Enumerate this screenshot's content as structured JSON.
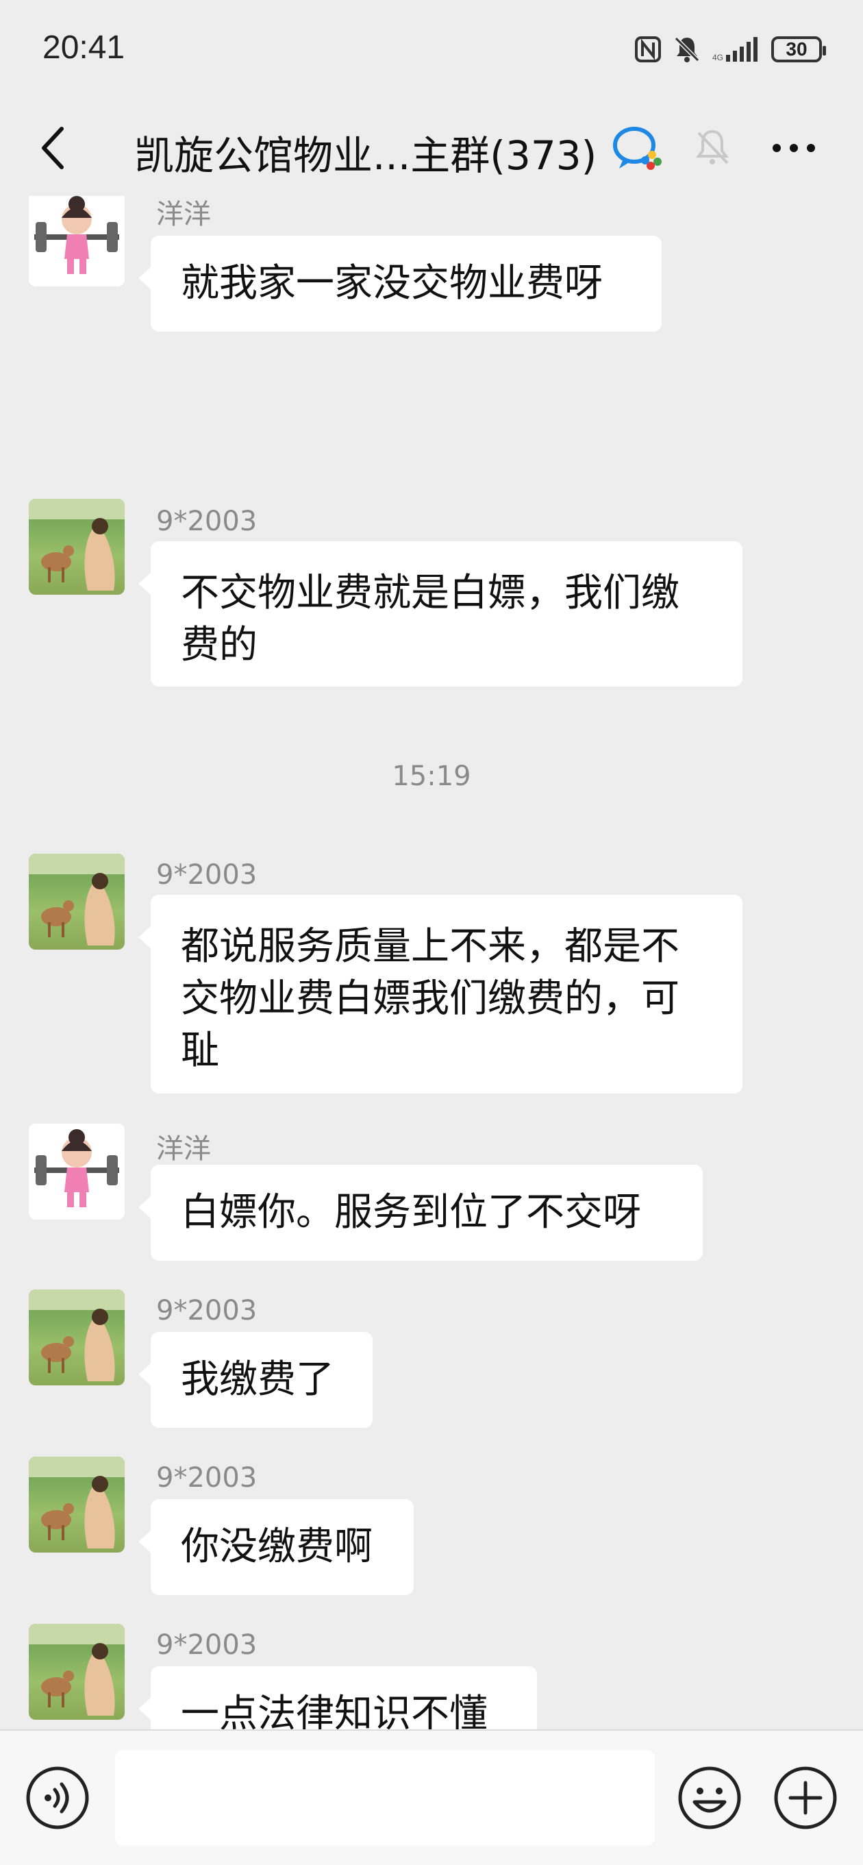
{
  "status_bar": {
    "time": "20:41",
    "battery": "30"
  },
  "header": {
    "title": "凯旋公馆物业...主群(373)"
  },
  "messages": [
    {
      "sender": "洋洋",
      "avatar": "girl-weightlifting-avatar",
      "text": "就我家一家没交物业费呀"
    },
    {
      "sender": "9*2003",
      "avatar": "deer-meadow-avatar",
      "text": "不交物业费就是白嫖，我们缴费的"
    },
    {
      "sender": "9*2003",
      "avatar": "deer-meadow-avatar",
      "text": "都说服务质量上不来，都是不交物业费白嫖我们缴费的，可耻"
    },
    {
      "sender": "洋洋",
      "avatar": "girl-weightlifting-avatar",
      "text": "白嫖你。服务到位了不交呀"
    },
    {
      "sender": "9*2003",
      "avatar": "deer-meadow-avatar",
      "text": "我缴费了"
    },
    {
      "sender": "9*2003",
      "avatar": "deer-meadow-avatar",
      "text": "你没缴费啊"
    },
    {
      "sender": "9*2003",
      "avatar": "deer-meadow-avatar",
      "text": "一点法律知识不懂"
    }
  ],
  "timestamps": [
    "15:19"
  ],
  "input": {
    "value": "",
    "placeholder": ""
  },
  "icons": {
    "back": "back-arrow-icon",
    "wecom": "wecom-icon",
    "mute": "mute-bell-icon",
    "more": "more-icon",
    "voice": "voice-icon",
    "emoji": "emoji-icon",
    "plus": "plus-icon"
  },
  "colors": {
    "background": "#ededed",
    "bubble": "#ffffff",
    "meta_text": "#8a8a8a"
  }
}
